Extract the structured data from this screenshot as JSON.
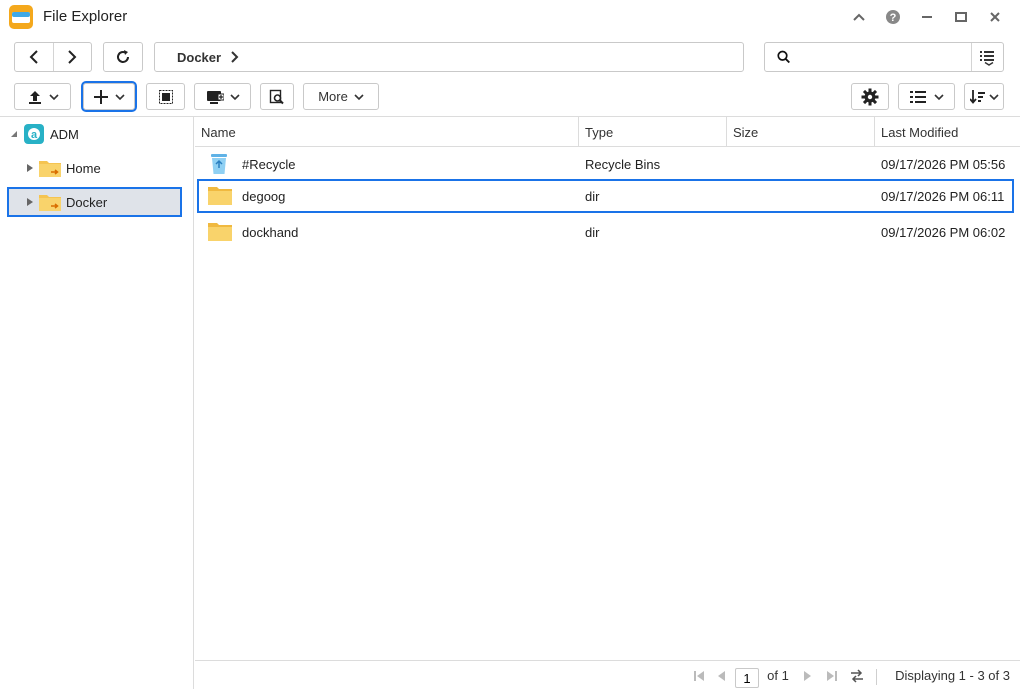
{
  "window": {
    "title": "File Explorer"
  },
  "nav": {
    "breadcrumb": "Docker",
    "search_placeholder": ""
  },
  "toolbar": {
    "more_label": "More"
  },
  "tree": {
    "root_label": "ADM",
    "items": [
      {
        "label": "Home"
      },
      {
        "label": "Docker"
      }
    ]
  },
  "list": {
    "columns": {
      "name": "Name",
      "type": "Type",
      "size": "Size",
      "modified": "Last Modified"
    },
    "rows": [
      {
        "name": "#Recycle",
        "type": "Recycle Bins",
        "size": "",
        "modified": "09/17/2026 PM 05:56",
        "icon": "recycle-bin-icon"
      },
      {
        "name": "degoog",
        "type": "dir",
        "size": "",
        "modified": "09/17/2026 PM 06:11",
        "icon": "folder-icon"
      },
      {
        "name": "dockhand",
        "type": "dir",
        "size": "",
        "modified": "09/17/2026 PM 06:02",
        "icon": "folder-icon"
      }
    ]
  },
  "status": {
    "page_value": "1",
    "page_of": "of 1",
    "displaying": "Displaying 1 - 3 of 3"
  },
  "colors": {
    "accent": "#1a73e8",
    "selection_bg": "#dfe3e9",
    "folder": "#f5c451"
  }
}
